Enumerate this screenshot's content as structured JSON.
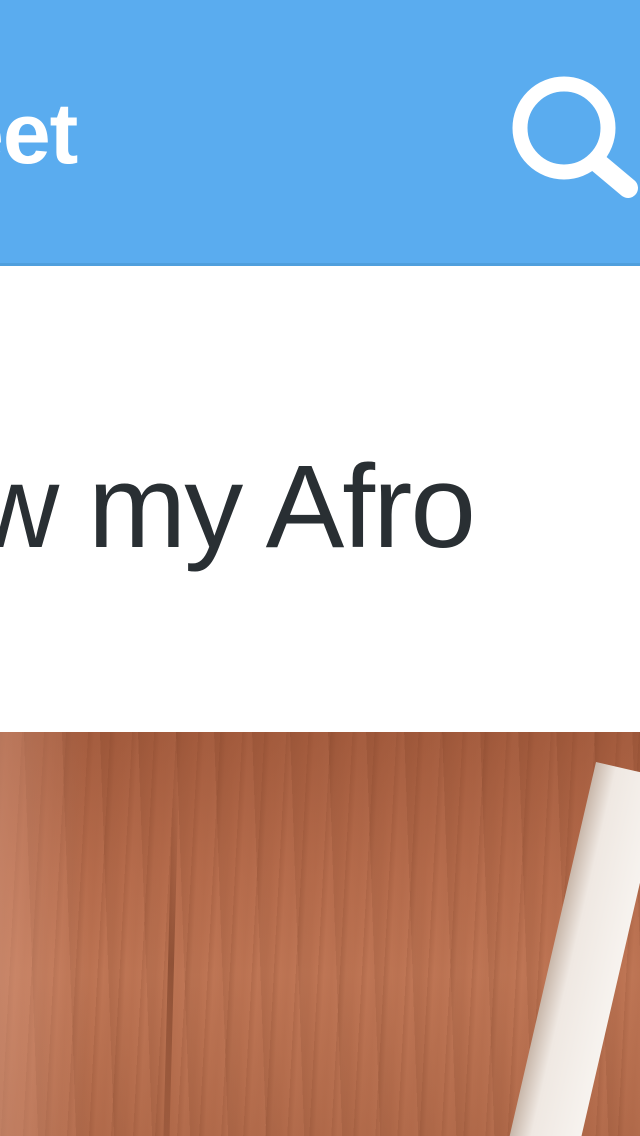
{
  "header": {
    "title": "eet",
    "search_icon": "search-icon",
    "background_color": "#5aacef"
  },
  "post": {
    "text": "w my Afro",
    "text_color": "#292f33",
    "image_description_icon": "photo"
  }
}
